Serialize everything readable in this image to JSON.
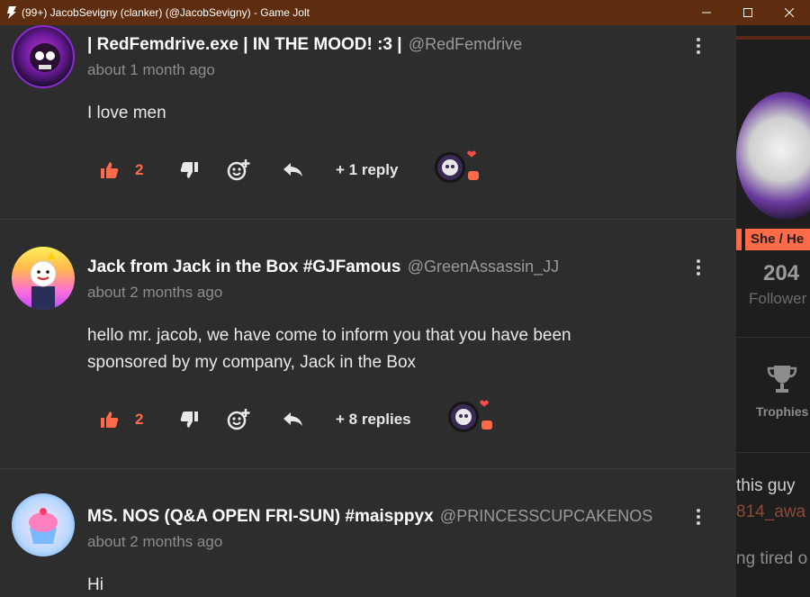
{
  "window": {
    "title": "(99+) JacobSevigny (clanker) (@JacobSevigny) - Game Jolt",
    "controls": [
      "minimize",
      "maximize",
      "close"
    ]
  },
  "comments": [
    {
      "display_name": "| RedFemdrive.exe | IN THE MOOD! :3 |",
      "handle": "@RedFemdrive",
      "time": "about 1 month ago",
      "body": "I love men",
      "likes": "2",
      "replies": "+ 1 reply",
      "avatar_icon": "skull-avatar"
    },
    {
      "display_name": "Jack from Jack in the Box #GJFamous",
      "handle": "@GreenAssassin_JJ",
      "time": "about 2 months ago",
      "body_line1": "hello mr. jacob, we have come to inform you that you have been",
      "body_line2": "sponsored by my company, Jack in the Box",
      "likes": "2",
      "replies": "+ 8 replies",
      "avatar_icon": "jack-mascot-avatar"
    },
    {
      "display_name": "MS. NOS (Q&A OPEN FRI-SUN) #maisppyx",
      "handle": "@PRINCESSCUPCAKENOS",
      "time": "about 2 months ago",
      "body": "Hi",
      "avatar_icon": "cupcake-cat-avatar"
    }
  ],
  "sidebar": {
    "pronoun_tag": "She / He",
    "follower_count": "204",
    "followers_label": "Follower",
    "trophies_label": "Trophies",
    "snippet1": "this guy",
    "snippet2": "814_awa",
    "snippet3": "ng tired o"
  },
  "colors": {
    "accent": "#ff6b4a",
    "titlebar": "#5e2d0f",
    "panel": "#2d2d2d"
  }
}
